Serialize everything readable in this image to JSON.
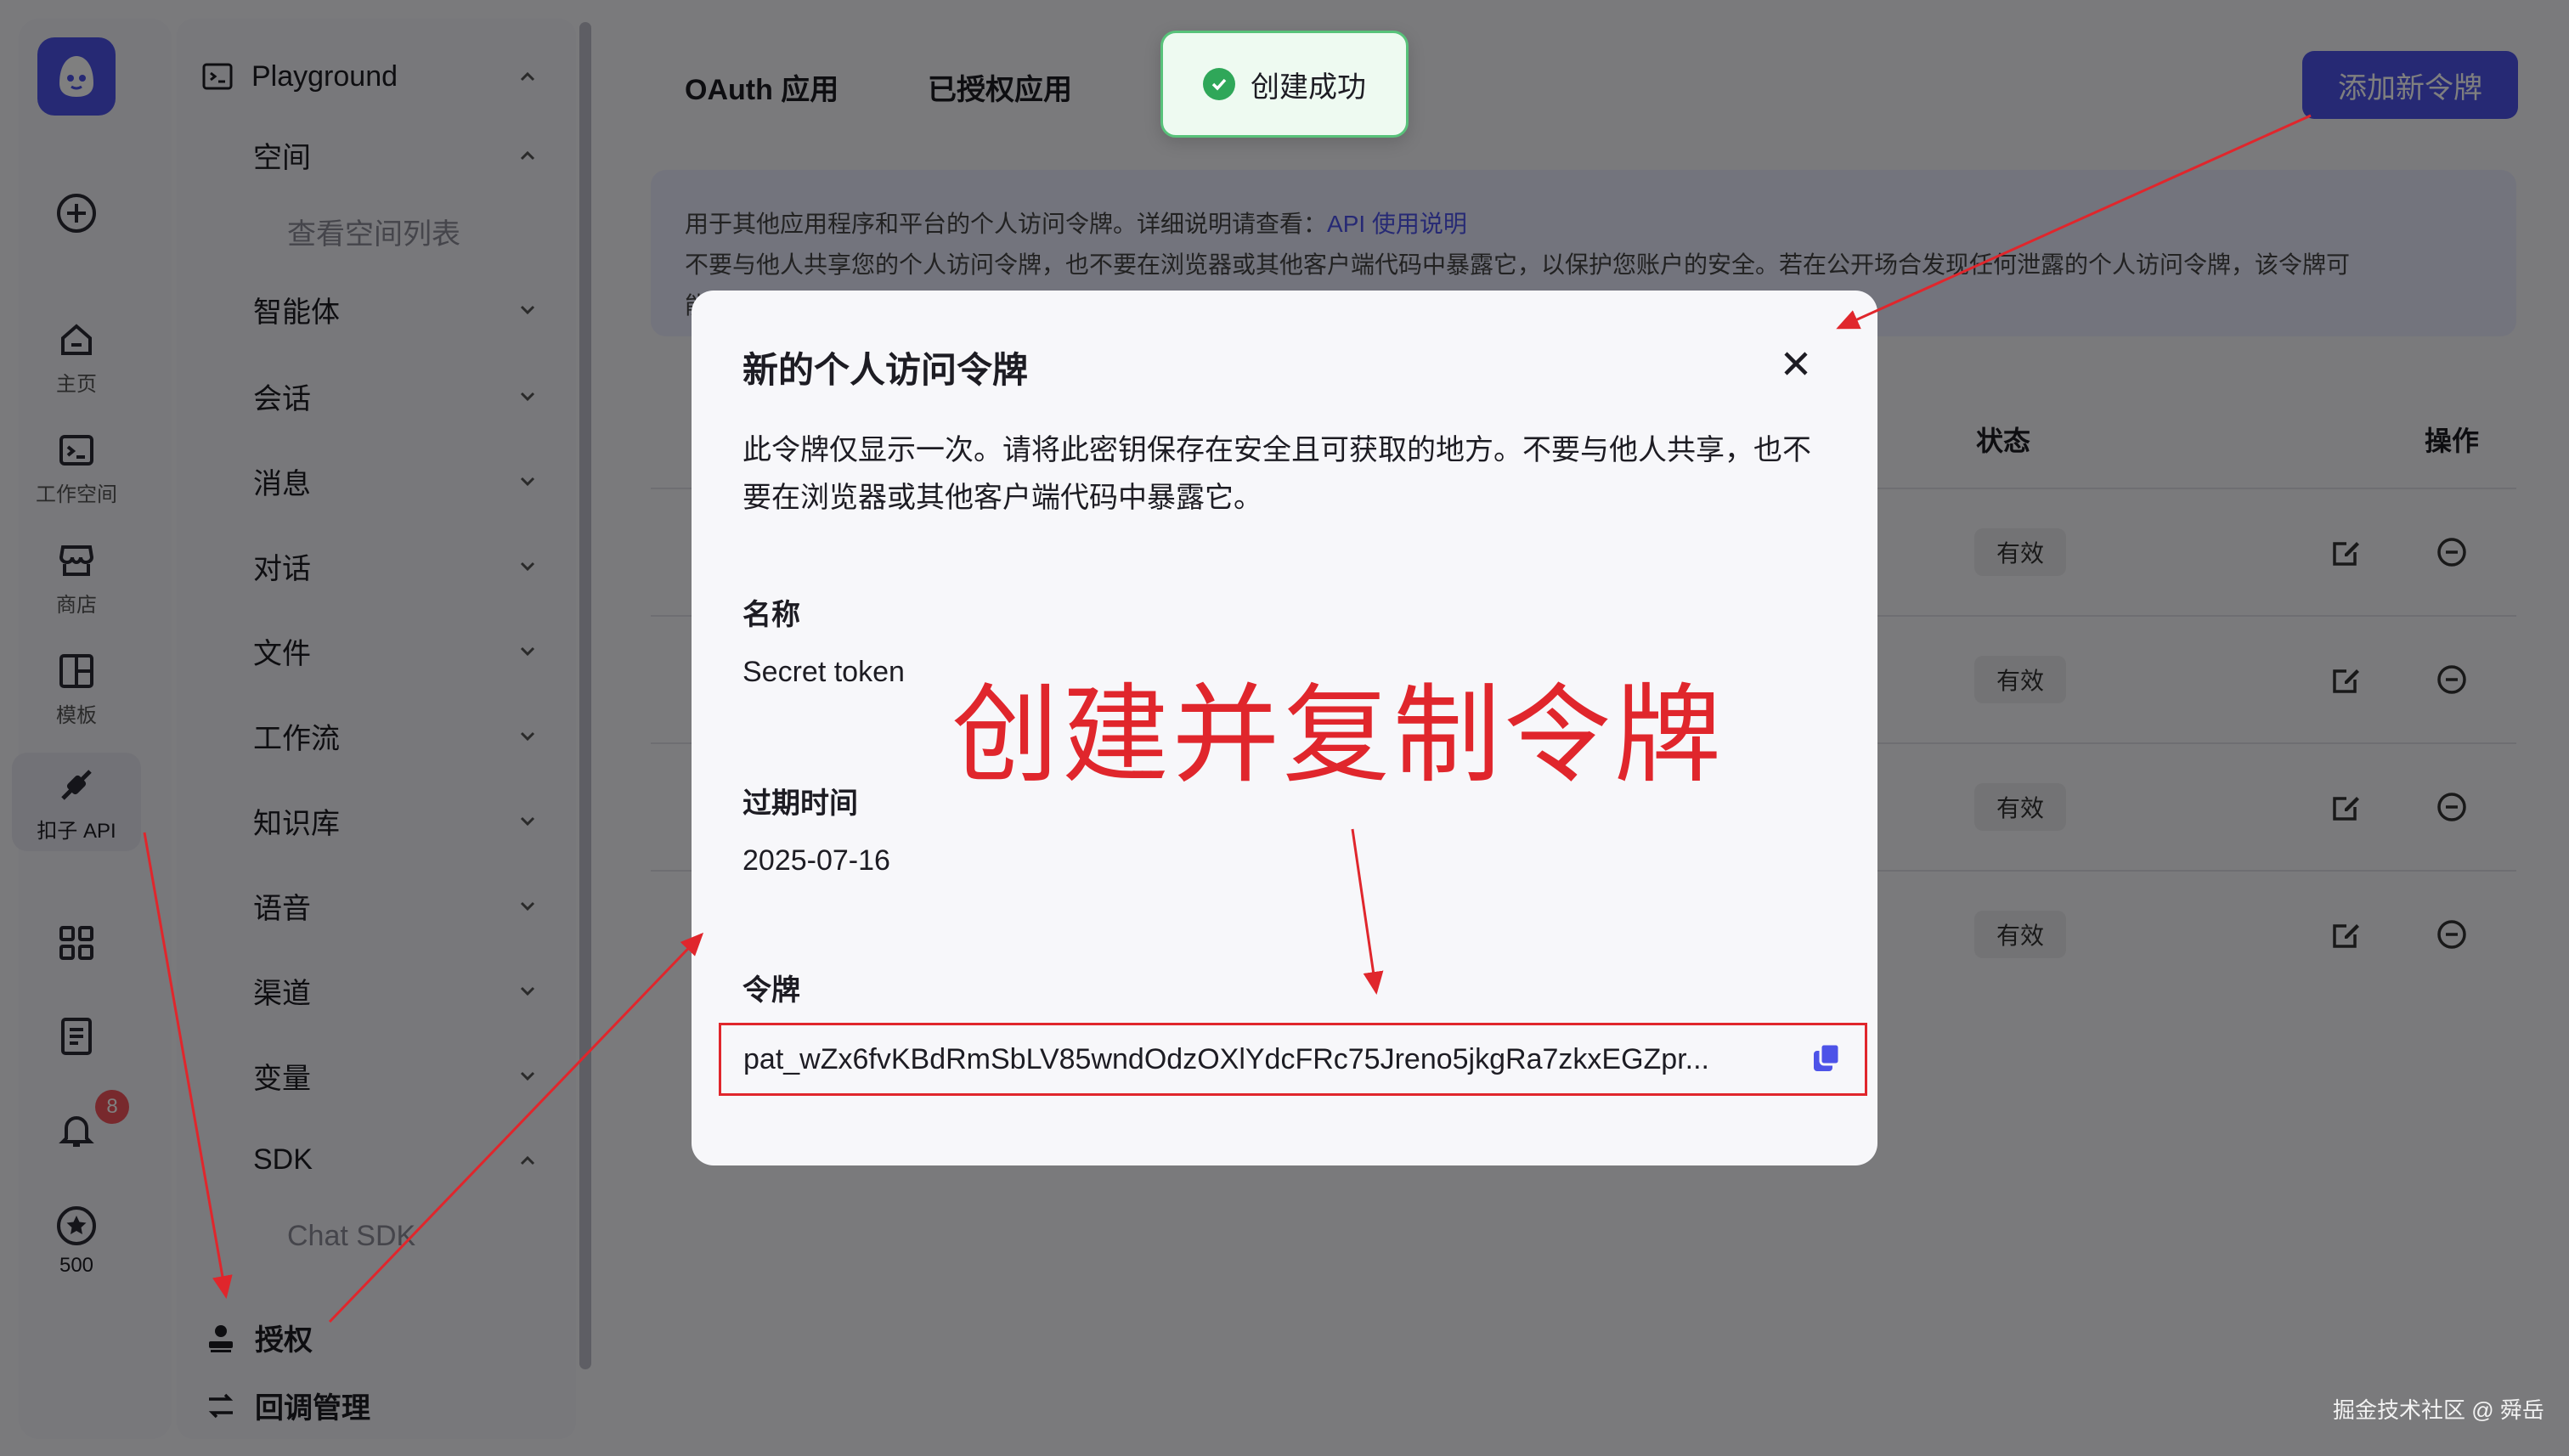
{
  "rail": {
    "items": [
      {
        "label": "主页",
        "icon": "home-icon"
      },
      {
        "label": "工作空间",
        "icon": "workspace-icon"
      },
      {
        "label": "商店",
        "icon": "store-icon"
      },
      {
        "label": "模板",
        "icon": "template-icon"
      },
      {
        "label": "扣子 API",
        "icon": "api-icon"
      }
    ],
    "notification_count": "8",
    "points": "500"
  },
  "nav": {
    "playground": "Playground",
    "space": "空间",
    "space_list": "查看空间列表",
    "items": [
      "智能体",
      "会话",
      "消息",
      "对话",
      "文件",
      "工作流",
      "知识库",
      "语音",
      "渠道",
      "变量"
    ],
    "sdk": "SDK",
    "chat_sdk": "Chat SDK",
    "auth": "授权",
    "callback": "回调管理"
  },
  "main": {
    "tabs": [
      "OAuth 应用",
      "已授权应用"
    ],
    "add_button": "添加新令牌",
    "notice_line1": "用于其他应用程序和平台的个人访问令牌。详细说明请查看：",
    "notice_link": "API 使用说明",
    "notice_line2": "不要与他人共享您的个人访问令牌，也不要在浏览器或其他客户端代码中暴露它，以保护您账户的安全。若在公开场合发现任何泄露的个人访问令牌，该令牌可",
    "notice_line3": "能会被自动禁用。",
    "headers": {
      "status": "状态",
      "action": "操作"
    },
    "rows": [
      {
        "status": "有效"
      },
      {
        "status": "有效"
      },
      {
        "status": "有效"
      },
      {
        "status": "有效"
      }
    ]
  },
  "toast": {
    "text": "创建成功"
  },
  "modal": {
    "title": "新的个人访问令牌",
    "description": "此令牌仅显示一次。请将此密钥保存在安全且可获取的地方。不要与他人共享，也不要在浏览器或其他客户端代码中暴露它。",
    "name_label": "名称",
    "name_value": "Secret token",
    "expire_label": "过期时间",
    "expire_value": "2025-07-16",
    "token_label": "令牌",
    "token_value": "pat_wZx6fvKBdRmSbLV85wndOdzOXlYdcFRc75Jreno5jkgRa7zkxEGZpr..."
  },
  "annotation": "创建并复制令牌",
  "watermark": "掘金技术社区 @ 舜岳",
  "colors": {
    "accent": "#4d53e8",
    "annotation_red": "#e0262c",
    "success_green": "#2fa759"
  }
}
